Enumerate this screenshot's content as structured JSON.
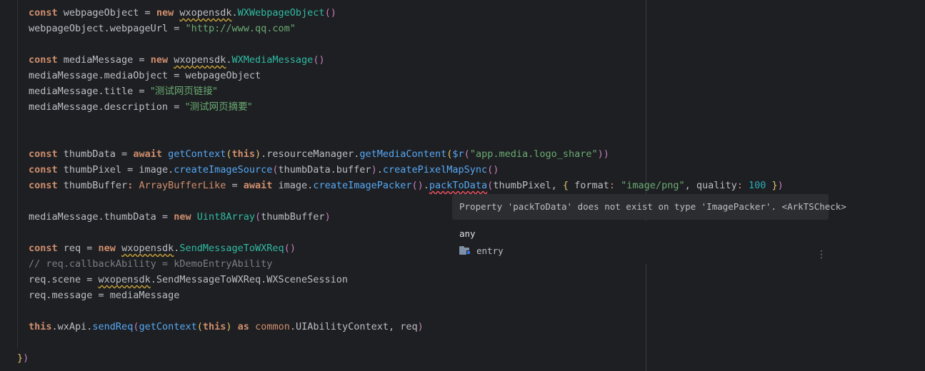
{
  "code": {
    "l1": {
      "kw": "const",
      "a": " webpageObject = ",
      "kw2": "new",
      "ns": "wxopensdk",
      "dot": ".",
      "cls": "WXWebpageObject",
      "p": "()"
    },
    "l2": {
      "a": "webpageObject.webpageUrl = ",
      "str": "\"http://www.qq.com\""
    },
    "l4": {
      "kw": "const",
      "a": " mediaMessage = ",
      "kw2": "new",
      "ns": "wxopensdk",
      "dot": ".",
      "cls": "WXMediaMessage",
      "p": "()"
    },
    "l5": {
      "a": "mediaMessage.mediaObject = webpageObject"
    },
    "l6": {
      "a": "mediaMessage.title = ",
      "str": "\"测试网页链接\""
    },
    "l7": {
      "a": "mediaMessage.description = ",
      "str": "\"测试网页摘要\""
    },
    "l10": {
      "kw": "const",
      "a": " thumbData = ",
      "kw2": "await",
      "fn": "getContext",
      "p1": "(",
      "kw3": "this",
      "p2": ")",
      "b": ".resourceManager.",
      "fn2": "getMediaContent",
      "p3": "(",
      "c": "$r",
      "p4": "(",
      "str": "\"app.media.logo_share\"",
      "p5": "))"
    },
    "l11": {
      "kw": "const",
      "a": " thumbPixel = image.",
      "fn": "createImageSource",
      "p1": "(",
      "b": "thumbData.buffer",
      "p2": ")",
      "dot": ".",
      "fn2": "createPixelMapSync",
      "p3": "()"
    },
    "l12": {
      "kw": "const",
      "a": " thumbBuffer",
      "colon": ": ",
      "typ": "ArrayBufferLike",
      "eq": " = ",
      "kw2": "await",
      "b": " image.",
      "fn": "createImagePacker",
      "p1": "()",
      "dot": ".",
      "fn2": "packToData",
      "p2": "(",
      "c": "thumbPixel, ",
      "br": "{",
      "d": " format",
      "colon2": ": ",
      "str": "\"image/png\"",
      "e": ", quality",
      "colon3": ": ",
      "num": "100",
      "br2": " }",
      "p3": ")"
    },
    "l14": {
      "a": "mediaMessage.thumbData = ",
      "kw": "new",
      "cls": "Uint8Array",
      "p1": "(",
      "b": "thumbBuffer",
      "p2": ")"
    },
    "l16": {
      "kw": "const",
      "a": " req = ",
      "kw2": "new",
      "ns": "wxopensdk",
      "dot": ".",
      "cls": "SendMessageToWXReq",
      "p": "()"
    },
    "l17": {
      "cmt": "// req.callbackAbility = kDemoEntryAbility"
    },
    "l18": {
      "a": "req.scene = ",
      "ns": "wxopensdk",
      "b": ".SendMessageToWXReq.WXSceneSession"
    },
    "l19": {
      "a": "req.message = mediaMessage"
    },
    "l21": {
      "kw": "this",
      "a": ".wxApi.",
      "fn": "sendReq",
      "p1": "(",
      "fn2": "getContext",
      "p2": "(",
      "kw2": "this",
      "p3": ")",
      "kw3": " as ",
      "cls": "common",
      "b": ".UIAbilityContext, req",
      "p4": ")"
    },
    "l23": {
      "br": "}",
      "p": ")"
    }
  },
  "tooltip": {
    "message": "Property 'packToData' does not exist on type 'ImagePacker'. <ArkTSCheck>"
  },
  "popup": {
    "type": "any",
    "module": "entry",
    "more": "⋮"
  }
}
